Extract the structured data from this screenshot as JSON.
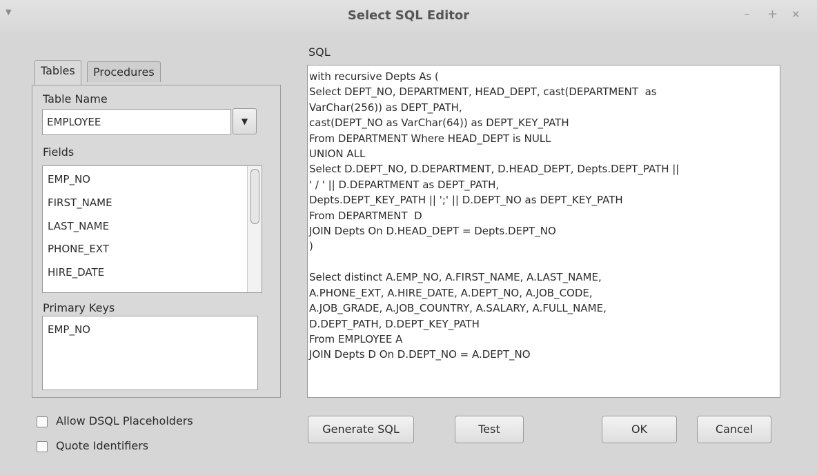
{
  "window": {
    "title": "Select SQL Editor",
    "menu_glyph": "▼",
    "minimize_glyph": "–",
    "maximize_glyph": "+",
    "close_glyph": "✕"
  },
  "tabs": [
    {
      "label": "Tables",
      "active": true
    },
    {
      "label": "Procedures",
      "active": false
    }
  ],
  "table_panel": {
    "table_name_label": "Table Name",
    "table_name_value": "EMPLOYEE",
    "dropdown_glyph": "▼",
    "fields_label": "Fields",
    "fields": [
      "EMP_NO",
      "FIRST_NAME",
      "LAST_NAME",
      "PHONE_EXT",
      "HIRE_DATE"
    ],
    "primary_keys_label": "Primary Keys",
    "primary_keys": [
      "EMP_NO"
    ]
  },
  "sql": {
    "label": "SQL",
    "text": "with recursive Depts As (\nSelect DEPT_NO, DEPARTMENT, HEAD_DEPT, cast(DEPARTMENT  as\nVarChar(256)) as DEPT_PATH,\ncast(DEPT_NO as VarChar(64)) as DEPT_KEY_PATH\nFrom DEPARTMENT Where HEAD_DEPT is NULL\nUNION ALL\nSelect D.DEPT_NO, D.DEPARTMENT, D.HEAD_DEPT, Depts.DEPT_PATH ||\n' / ' || D.DEPARTMENT as DEPT_PATH,\nDepts.DEPT_KEY_PATH || ';' || D.DEPT_NO as DEPT_KEY_PATH\nFrom DEPARTMENT  D\nJOIN Depts On D.HEAD_DEPT = Depts.DEPT_NO\n)\n\nSelect distinct A.EMP_NO, A.FIRST_NAME, A.LAST_NAME,\nA.PHONE_EXT, A.HIRE_DATE, A.DEPT_NO, A.JOB_CODE,\nA.JOB_GRADE, A.JOB_COUNTRY, A.SALARY, A.FULL_NAME,\nD.DEPT_PATH, D.DEPT_KEY_PATH\nFrom EMPLOYEE A\nJOIN Depts D On D.DEPT_NO = A.DEPT_NO"
  },
  "options": {
    "allow_dsql_placeholders": {
      "label": "Allow DSQL Placeholders",
      "checked": false
    },
    "quote_identifiers": {
      "label": "Quote Identifiers",
      "checked": false
    }
  },
  "buttons": {
    "generate_sql": "Generate SQL",
    "test": "Test",
    "ok": "OK",
    "cancel": "Cancel"
  }
}
